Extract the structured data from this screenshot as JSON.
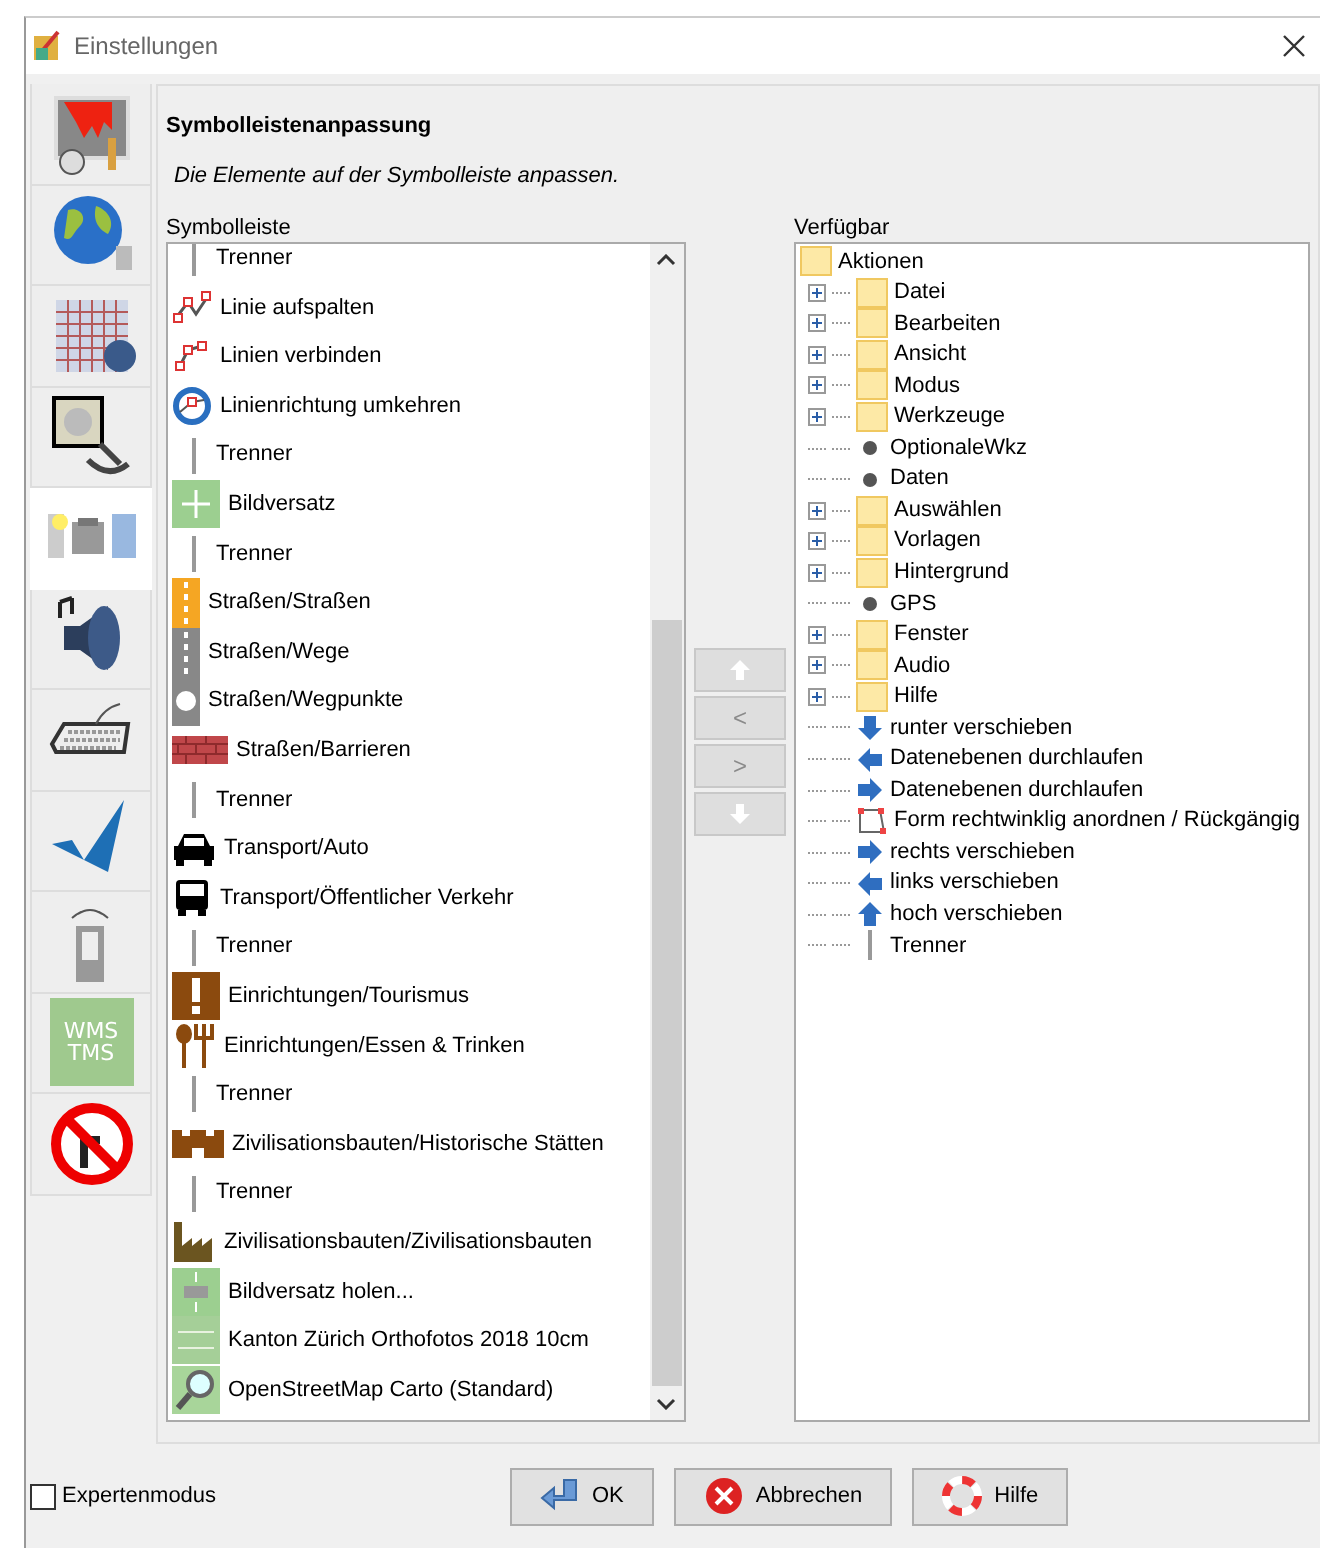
{
  "window": {
    "title": "Einstellungen"
  },
  "tabs": [
    {
      "kind": "paint",
      "selected": false
    },
    {
      "kind": "globe",
      "selected": false
    },
    {
      "kind": "grid",
      "selected": false
    },
    {
      "kind": "plug",
      "selected": false
    },
    {
      "kind": "toolbar",
      "selected": true
    },
    {
      "kind": "speaker",
      "selected": false
    },
    {
      "kind": "keyboard",
      "selected": false
    },
    {
      "kind": "check",
      "selected": false
    },
    {
      "kind": "remote",
      "selected": false
    },
    {
      "kind": "wms",
      "selected": false,
      "text_lines": [
        "WMS",
        "TMS"
      ]
    },
    {
      "kind": "noturn",
      "selected": false
    }
  ],
  "panel": {
    "title": "Symbolleistenanpassung",
    "description": "Die Elemente auf der Symbolleiste anpassen."
  },
  "toolbar_list": {
    "label": "Symbolleiste",
    "items": [
      {
        "kind": "separator",
        "label": "Trenner"
      },
      {
        "kind": "split",
        "label": "Linie aufspalten"
      },
      {
        "kind": "join",
        "label": "Linien verbinden"
      },
      {
        "kind": "reverse",
        "label": "Linienrichtung umkehren"
      },
      {
        "kind": "separator",
        "label": "Trenner"
      },
      {
        "kind": "offset",
        "label": "Bildversatz"
      },
      {
        "kind": "separator",
        "label": "Trenner"
      },
      {
        "kind": "road-orange",
        "label": "Straßen/Straßen"
      },
      {
        "kind": "road-gray",
        "label": "Straßen/Wege"
      },
      {
        "kind": "waypoint",
        "label": "Straßen/Wegpunkte"
      },
      {
        "kind": "barrier",
        "label": "Straßen/Barrieren"
      },
      {
        "kind": "separator",
        "label": "Trenner"
      },
      {
        "kind": "car",
        "label": "Transport/Auto"
      },
      {
        "kind": "bus",
        "label": "Transport/Öffentlicher Verkehr"
      },
      {
        "kind": "separator",
        "label": "Trenner"
      },
      {
        "kind": "tourism",
        "label": "Einrichtungen/Tourismus"
      },
      {
        "kind": "food",
        "label": "Einrichtungen/Essen & Trinken"
      },
      {
        "kind": "separator",
        "label": "Trenner"
      },
      {
        "kind": "castle",
        "label": "Zivilisationsbauten/Historische Stätten"
      },
      {
        "kind": "separator",
        "label": "Trenner"
      },
      {
        "kind": "factory",
        "label": "Zivilisationsbauten/Zivilisationsbauten"
      },
      {
        "kind": "offset-get",
        "label": "Bildversatz holen..."
      },
      {
        "kind": "wms",
        "label": "Kanton Zürich Orthofotos 2018 10cm"
      },
      {
        "kind": "osm",
        "label": "OpenStreetMap Carto (Standard)"
      }
    ]
  },
  "move_buttons": [
    {
      "kind": "up",
      "disabled": true
    },
    {
      "kind": "text",
      "label": "<",
      "disabled": true
    },
    {
      "kind": "text",
      "label": ">",
      "disabled": true
    },
    {
      "kind": "down",
      "disabled": true
    }
  ],
  "available_tree": {
    "label": "Verfügbar",
    "root": {
      "kind": "folder",
      "label": "Aktionen",
      "children": [
        {
          "kind": "folder",
          "label": "Datei",
          "expanded": false
        },
        {
          "kind": "folder",
          "label": "Bearbeiten",
          "expanded": false
        },
        {
          "kind": "folder",
          "label": "Ansicht",
          "expanded": false
        },
        {
          "kind": "folder",
          "label": "Modus",
          "expanded": false
        },
        {
          "kind": "folder",
          "label": "Werkzeuge",
          "expanded": false
        },
        {
          "kind": "dot",
          "label": "OptionaleWkz"
        },
        {
          "kind": "dot",
          "label": "Daten"
        },
        {
          "kind": "folder",
          "label": "Auswählen",
          "expanded": false
        },
        {
          "kind": "folder",
          "label": "Vorlagen",
          "expanded": false
        },
        {
          "kind": "folder",
          "label": "Hintergrund",
          "expanded": false
        },
        {
          "kind": "dot",
          "label": "GPS"
        },
        {
          "kind": "folder",
          "label": "Fenster",
          "expanded": false
        },
        {
          "kind": "folder",
          "label": "Audio",
          "expanded": false
        },
        {
          "kind": "folder",
          "label": "Hilfe",
          "expanded": false
        },
        {
          "kind": "arrow-down",
          "label": "runter verschieben"
        },
        {
          "kind": "arrow-left",
          "label": "Datenebenen durchlaufen"
        },
        {
          "kind": "arrow-right",
          "label": "Datenebenen durchlaufen"
        },
        {
          "kind": "shape",
          "label": "Form rechtwinklig anordnen / Rückgängig"
        },
        {
          "kind": "arrow-right",
          "label": "rechts verschieben"
        },
        {
          "kind": "arrow-left",
          "label": "links verschieben"
        },
        {
          "kind": "arrow-up",
          "label": "hoch verschieben"
        },
        {
          "kind": "separator",
          "label": "Trenner"
        }
      ]
    }
  },
  "expert_mode": {
    "label": "Expertenmodus",
    "checked": false
  },
  "buttons": [
    {
      "kind": "ok",
      "label": "OK"
    },
    {
      "kind": "cancel",
      "label": "Abbrechen"
    },
    {
      "kind": "help",
      "label": "Hilfe"
    }
  ]
}
